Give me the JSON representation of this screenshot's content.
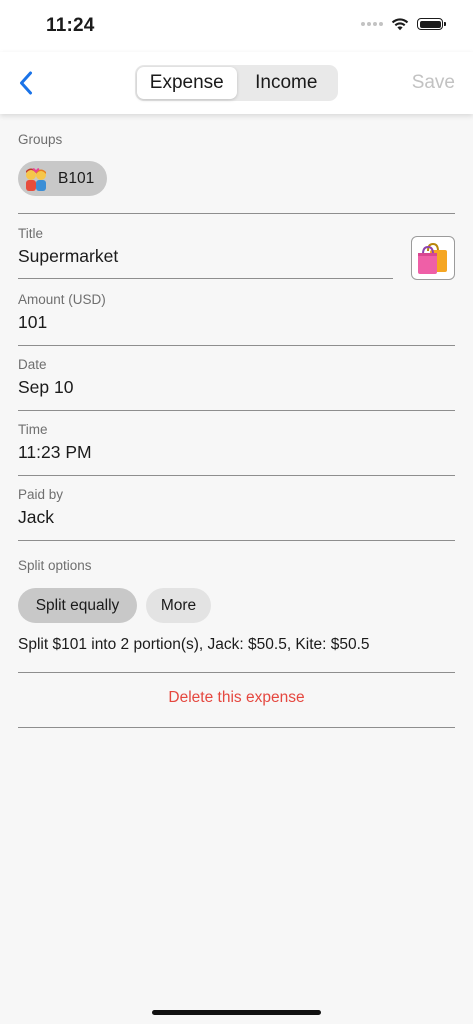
{
  "status_bar": {
    "time": "11:24"
  },
  "nav": {
    "segments": [
      "Expense",
      "Income"
    ],
    "active_segment": "Expense",
    "save_label": "Save",
    "accent_color": "#1a73e8"
  },
  "form": {
    "groups_label": "Groups",
    "group_chip": {
      "emoji": "👩‍❤️‍👨",
      "name": "B101"
    },
    "title_label": "Title",
    "title_value": "Supermarket",
    "category_icon": "shopping-bags-icon",
    "amount_label": "Amount (USD)",
    "amount_value": "101",
    "date_label": "Date",
    "date_value": "Sep 10",
    "time_label": "Time",
    "time_value": "11:23 PM",
    "paid_by_label": "Paid by",
    "paid_by_value": "Jack",
    "split_label": "Split options",
    "split_options": [
      "Split equally",
      "More"
    ],
    "selected_split": "Split equally",
    "split_summary": "Split $101 into 2 portion(s), Jack: $50.5, Kite: $50.5",
    "delete_label": "Delete this expense",
    "delete_color": "#e5473f"
  }
}
